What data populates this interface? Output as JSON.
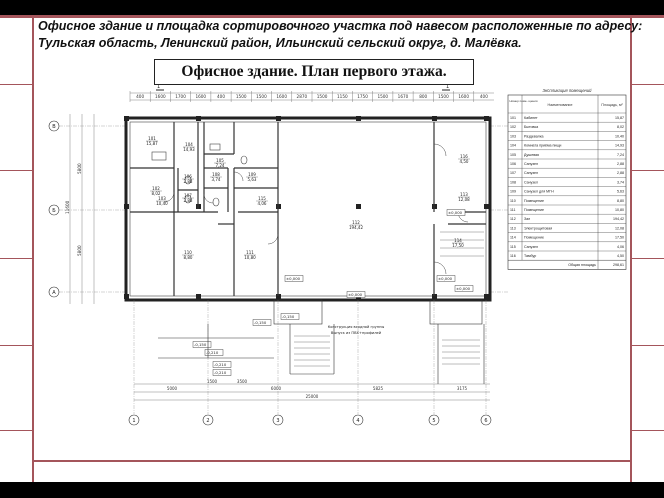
{
  "header": {
    "line1": "Офисное здание и площадка сортировочного участка под навесом расположенные по адресу:",
    "line2": "Тульская область, Ленинский район, Ильинский сельский округ, д. Малёвка."
  },
  "subtitle": "Офисное здание. План первого этажа.",
  "colors": {
    "frame": "#a4555b",
    "bars": "#000000",
    "drawing": "#333333"
  },
  "plan": {
    "top_dims": [
      "400",
      "1600",
      "1700",
      "1600",
      "400",
      "1500",
      "1500",
      "1600",
      "2870",
      "1500",
      "1150",
      "1750",
      "1500",
      "1670",
      "800",
      "1500",
      "1600",
      "400"
    ],
    "axis_letters": [
      "В",
      "Б",
      "А"
    ],
    "axis_numbers": [
      "1",
      "2",
      "3",
      "4",
      "5",
      "6"
    ],
    "side_dims": [
      "5800",
      "5800",
      "11600"
    ],
    "bottom_dims": [
      "5000",
      "6000",
      "5825",
      "3175"
    ],
    "bottom_total": "25000",
    "bottom_subdims": [
      "1500",
      "3500"
    ],
    "rooms": [
      {
        "num": "101",
        "area": "15,87"
      },
      {
        "num": "102",
        "area": "8,02"
      },
      {
        "num": "103",
        "area": "10,40"
      },
      {
        "num": "104",
        "area": "14,93"
      },
      {
        "num": "105",
        "area": "7,24"
      },
      {
        "num": "106",
        "area": "2,88"
      },
      {
        "num": "107",
        "area": "2,88"
      },
      {
        "num": "108",
        "area": "3,74"
      },
      {
        "num": "109",
        "area": "5,63"
      },
      {
        "num": "110",
        "area": "8,80"
      },
      {
        "num": "111",
        "area": "10,80"
      },
      {
        "num": "112",
        "area": "194,42"
      },
      {
        "num": "113",
        "area": "12,08"
      },
      {
        "num": "114",
        "area": "17,50"
      },
      {
        "num": "115",
        "area": "4,06"
      },
      {
        "num": "116",
        "area": "4,50"
      }
    ],
    "level_marks": [
      "±0,000",
      "-0,150",
      "±0,000",
      "±0,000",
      "-0,150",
      "-0,150",
      "-0,210",
      "±0,000",
      "-0,210",
      "-0,210",
      "±0,000"
    ],
    "note_line1": "Конструкция входной группы",
    "note_line2": "Выпуск из ПВХ+профилей",
    "section_marks": [
      "1",
      "1"
    ],
    "legend": {
      "title": "Экспликация помещений",
      "col_num": "Номер поме- щения",
      "col_name": "Наименование",
      "col_area": "Площадь, м²",
      "rows": [
        {
          "num": "101",
          "name": "Кабинет",
          "area": "15,87"
        },
        {
          "num": "102",
          "name": "Бытовка",
          "area": "8,02"
        },
        {
          "num": "103",
          "name": "Раздевалка",
          "area": "10,40"
        },
        {
          "num": "104",
          "name": "Комната приёма пищи",
          "area": "14,93"
        },
        {
          "num": "105",
          "name": "Душевая",
          "area": "7,24"
        },
        {
          "num": "106",
          "name": "Санузел",
          "area": "2,88"
        },
        {
          "num": "107",
          "name": "Санузел",
          "area": "2,88"
        },
        {
          "num": "108",
          "name": "Санузел",
          "area": "3,74"
        },
        {
          "num": "109",
          "name": "Санузел для МГН",
          "area": "5,63"
        },
        {
          "num": "110",
          "name": "Помещение",
          "area": "8,80"
        },
        {
          "num": "111",
          "name": "Помещение",
          "area": "10,80"
        },
        {
          "num": "112",
          "name": "Зал",
          "area": "194,42"
        },
        {
          "num": "113",
          "name": "Электрощитовая",
          "area": "12,08"
        },
        {
          "num": "114",
          "name": "Помещение",
          "area": "17,50"
        },
        {
          "num": "115",
          "name": "Санузел",
          "area": "4,06"
        },
        {
          "num": "116",
          "name": "Тамбур",
          "area": "4,50"
        }
      ],
      "total_label": "Общая площадь",
      "total_value": "298,61"
    }
  }
}
